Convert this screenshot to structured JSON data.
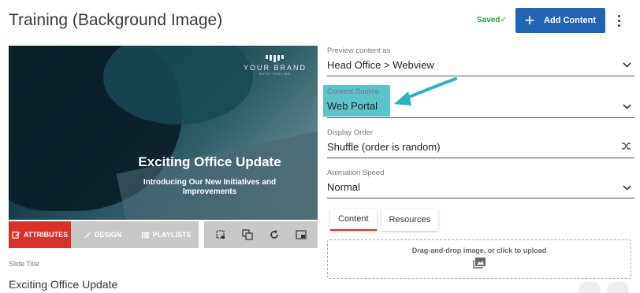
{
  "header": {
    "title": "Training (Background Image)",
    "saved": "Saved",
    "add_content": "Add Content"
  },
  "preview": {
    "brand_name": "YOUR BRAND",
    "brand_tagline": "WITH TAGLINE",
    "headline": "Exciting Office Update",
    "subheadline": "Introducing Our New Initiatives and Improvements"
  },
  "tabs": {
    "attributes": "ATTRIBUTES",
    "design": "DESIGN",
    "playlists": "PLAYLISTS"
  },
  "slide_title": {
    "label": "Slide Title",
    "value": "Exciting Office Update"
  },
  "form": {
    "preview_as": {
      "label": "Preview content as",
      "value": "Head Office > Webview"
    },
    "content_source": {
      "label": "Content Source",
      "value": "Web Portal"
    },
    "display_order": {
      "label": "Display Order",
      "value": "Shuffle (order is random)"
    },
    "animation_speed": {
      "label": "Animation Speed",
      "value": "Normal"
    }
  },
  "content_tabs": {
    "content": "Content",
    "resources": "Resources"
  },
  "upload": {
    "text": "Drag-and-drop image, or click to upload"
  },
  "colors": {
    "accent_blue": "#1f65b3",
    "accent_red": "#d8312a",
    "highlight_teal": "#5dc4cb",
    "saved_green": "#2e9e3e"
  }
}
